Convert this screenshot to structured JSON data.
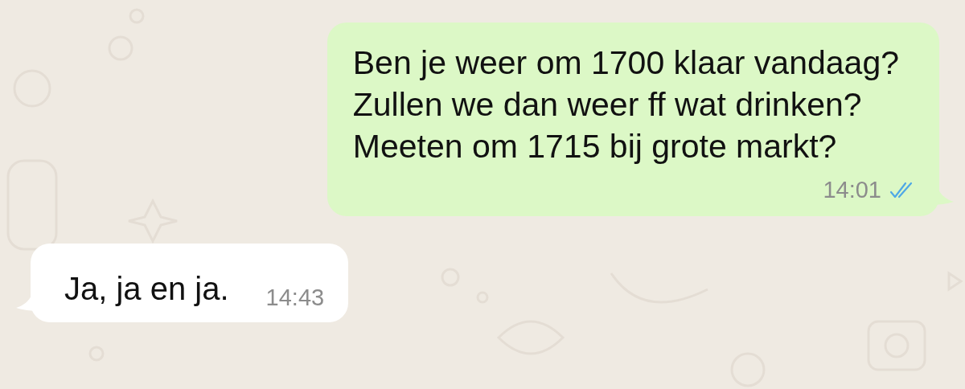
{
  "messages": [
    {
      "kind": "outgoing",
      "lines": [
        "Ben je weer om 1700 klaar vandaag?",
        "Zullen we dan weer ff wat drinken?",
        "Meeten om 1715 bij grote markt?"
      ],
      "time": "14:01",
      "read": true
    },
    {
      "kind": "incoming",
      "lines": [
        "Ja, ja en ja."
      ],
      "time": "14:43"
    }
  ]
}
